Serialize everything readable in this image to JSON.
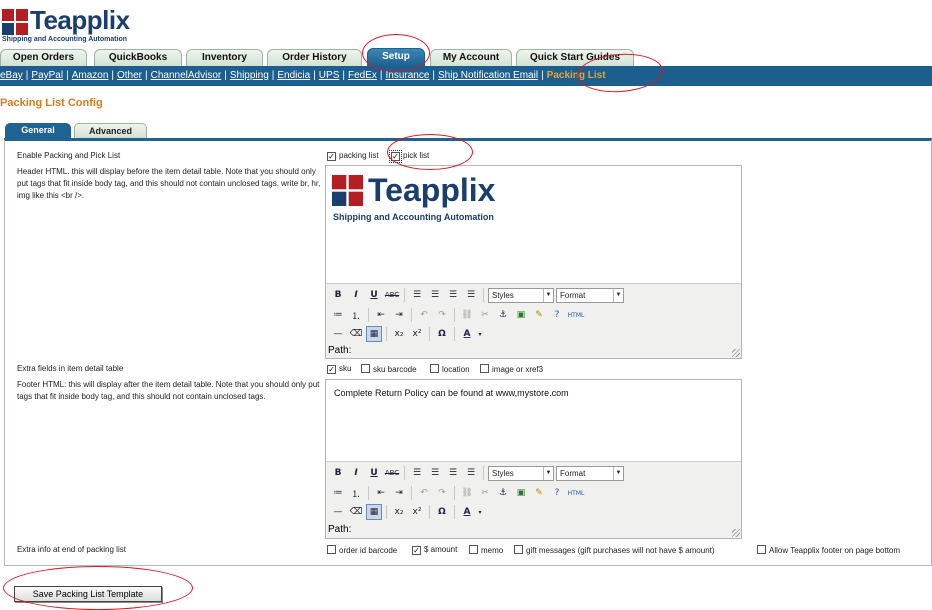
{
  "brand": {
    "name": "Teapplix",
    "tagline": "Shipping and Accounting Automation",
    "colors": {
      "primary": "#1a3e6e",
      "mark_red": "#b31e23",
      "nav": "#1c5f8f",
      "accent": "#d97a1b",
      "annotation": "#e0161b"
    }
  },
  "tabs": [
    {
      "label": "Open Orders"
    },
    {
      "label": "QuickBooks"
    },
    {
      "label": "Inventory"
    },
    {
      "label": "Order History"
    },
    {
      "label": "Setup",
      "active": true
    },
    {
      "label": "My Account"
    },
    {
      "label": "Quick Start Guides"
    }
  ],
  "subnav": [
    "eBay",
    "PayPal",
    "Amazon",
    "Other",
    "ChannelAdvisor",
    "Shipping",
    "Endicia",
    "UPS",
    "FedEx",
    "Insurance",
    "Ship Notification Email",
    "Packing List"
  ],
  "page_title": "Packing List Config",
  "inner_tabs": {
    "general": "General",
    "advanced": "Advanced"
  },
  "form": {
    "enable": {
      "label": "Enable Packing and Pick List",
      "options": [
        {
          "label": "packing list",
          "checked": true
        },
        {
          "label": "pick list",
          "checked": true
        }
      ]
    },
    "header_html": {
      "label": "Header HTML. this will display before the item detail table. Note that you should only put tags that fit inside body tag, and this should not contain unclosed tags. write br, hr, img like this <br />."
    },
    "extra_fields": {
      "label": "Extra fields in item detail table",
      "options": [
        {
          "label": "sku",
          "checked": true
        },
        {
          "label": "sku barcode",
          "checked": false
        },
        {
          "label": "location",
          "checked": false
        },
        {
          "label": "image or xref3",
          "checked": false
        }
      ]
    },
    "footer_html": {
      "label": "Footer HTML: this will display after the item detail table. Note that you should only put tags that fit inside body tag, and this should not contain unclosed tags.",
      "content": "Complete Return Policy can be found at www,mystore.com"
    },
    "extra_info": {
      "label": "Extra info at end of packing list",
      "options": [
        {
          "label": "order id barcode",
          "checked": false
        },
        {
          "label": "$ amount",
          "checked": true
        },
        {
          "label": "memo",
          "checked": false
        },
        {
          "label": "gift messages (gift purchases will not have $ amount)",
          "checked": false
        },
        {
          "label": "Allow Teapplix footer on page bottom",
          "checked": false
        }
      ]
    }
  },
  "editor": {
    "styles_label": "Styles",
    "format_label": "Format",
    "path_label": "Path:",
    "html_button": "HTML"
  },
  "save_button": "Save Packing List Template"
}
